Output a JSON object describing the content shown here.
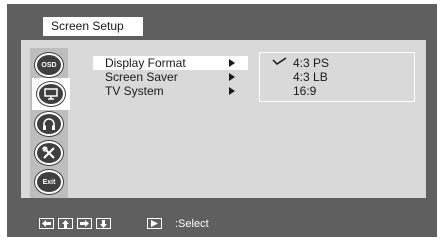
{
  "header": {
    "title": "Screen Setup"
  },
  "sidebar": {
    "items": [
      {
        "icon": "osd-icon",
        "label": "OSD"
      },
      {
        "icon": "monitor-icon",
        "label": ""
      },
      {
        "icon": "headphones-icon",
        "label": ""
      },
      {
        "icon": "tools-icon",
        "label": ""
      },
      {
        "icon": "exit-icon",
        "label": "Exit"
      }
    ]
  },
  "menu": {
    "items": [
      {
        "label": "Display Format"
      },
      {
        "label": "Screen Saver"
      },
      {
        "label": "TV System"
      }
    ]
  },
  "options": {
    "items": [
      {
        "label": "4:3 PS"
      },
      {
        "label": "4:3 LB"
      },
      {
        "label": "16:9"
      }
    ]
  },
  "footer": {
    "select_text": ":Select"
  },
  "colors": {
    "frame": "#5f5f5f",
    "panel": "#d9d9d9",
    "sidebar": "#bdbdbd",
    "highlight": "#ffffff"
  }
}
